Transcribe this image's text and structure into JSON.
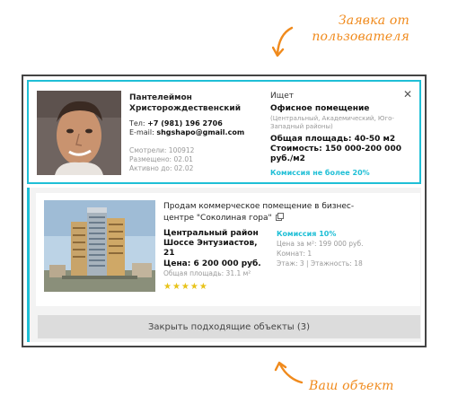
{
  "annotations": {
    "top_note": "Заявка от пользователя",
    "bottom_note": "Ваш объект"
  },
  "request": {
    "user": {
      "name": "Пантелеймон Христорождественский",
      "phone_label": "Тел:",
      "phone": "+7 (981) 196 2706",
      "email_label": "E-mail:",
      "email": "shgshapo@gmail.com",
      "views": "Смотрели: 100912",
      "posted": "Размещено: 02.01",
      "active": "Активно до: 02.02"
    },
    "want": {
      "label": "Ищет",
      "type": "Офисное помещение",
      "districts": "(Центральный, Академический, Юго-Западный районы)",
      "area": "Общая площадь: 40-50 м2",
      "cost": "Стоимость: 150 000-200 000 руб./м2",
      "commission": "Комиссия не более 20%"
    },
    "close_icon": "close-icon"
  },
  "object": {
    "title": "Продам коммерческое помещение в бизнес-центре \"Соколиная гора\"",
    "location": "Центральный район Шоссе Энтузиастов, 21",
    "price": "Цена: 6 200 000 руб.",
    "total_area": "Общая площадь: 31.1 м²",
    "rating": 5,
    "stars": "★★★★★",
    "commission": "Комиссия 10%",
    "price_per_m2": "Цена за м²: 199 000 руб.",
    "rooms": "Комнат: 1",
    "floor": "Этаж: 3 | Этажность: 18"
  },
  "actions": {
    "close_matching": "Закрыть подходящие объекты (3)"
  },
  "colors": {
    "accent": "#1fbfd6",
    "annotation": "#f08a1c",
    "stars": "#e8c31a"
  }
}
